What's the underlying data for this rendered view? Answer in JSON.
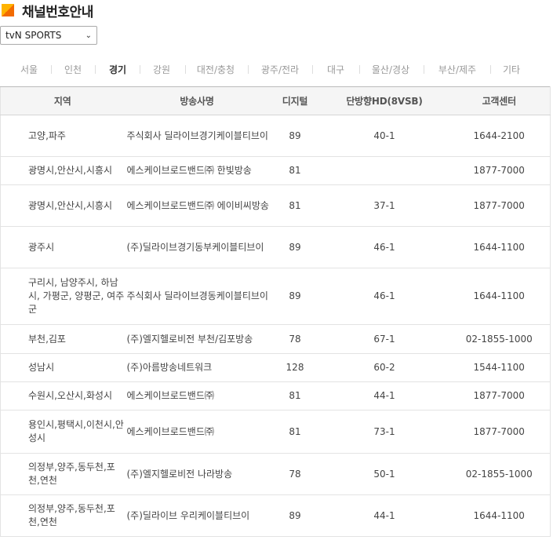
{
  "header": {
    "title": "채널번호안내"
  },
  "channel_select": {
    "value": "tvN SPORTS"
  },
  "tabs": [
    {
      "label": "서울",
      "active": false
    },
    {
      "label": "인천",
      "active": false
    },
    {
      "label": "경기",
      "active": true
    },
    {
      "label": "강원",
      "active": false
    },
    {
      "label": "대전/충청",
      "active": false
    },
    {
      "label": "광주/전라",
      "active": false
    },
    {
      "label": "대구",
      "active": false
    },
    {
      "label": "울산/경상",
      "active": false
    },
    {
      "label": "부산/제주",
      "active": false
    },
    {
      "label": "기타",
      "active": false
    }
  ],
  "table": {
    "headers": [
      "지역",
      "방송사명",
      "디지털",
      "단방향HD(8VSB)",
      "고객센터"
    ],
    "rows": [
      {
        "region": "고양,파주",
        "provider": "주식회사 딜라이브경기케이블티브이",
        "digital": "89",
        "hd": "40-1",
        "phone": "1644-2100"
      },
      {
        "region": "광명시,안산시,시흥시",
        "provider": "에스케이브로드밴드㈜ 한빛방송",
        "digital": "81",
        "hd": "",
        "phone": "1877-7000"
      },
      {
        "region": "광명시,안산시,시흥시",
        "provider": "에스케이브로드밴드㈜ 에이비씨방송",
        "digital": "81",
        "hd": "37-1",
        "phone": "1877-7000"
      },
      {
        "region": "광주시",
        "provider": "(주)딜라이브경기동부케이블티브이",
        "digital": "89",
        "hd": "46-1",
        "phone": "1644-1100"
      },
      {
        "region": "구리시, 남양주시, 하남시, 가평군, 양평군, 여주군",
        "provider": "주식회사 딜라이브경동케이블티브이",
        "digital": "89",
        "hd": "46-1",
        "phone": "1644-1100"
      },
      {
        "region": "부천,김포",
        "provider": "(주)엘지헬로비전 부천/김포방송",
        "digital": "78",
        "hd": "67-1",
        "phone": "02-1855-1000"
      },
      {
        "region": "성남시",
        "provider": "(주)아름방송네트워크",
        "digital": "128",
        "hd": "60-2",
        "phone": "1544-1100"
      },
      {
        "region": "수원시,오산시,화성시",
        "provider": "에스케이브로드밴드㈜",
        "digital": "81",
        "hd": "44-1",
        "phone": "1877-7000"
      },
      {
        "region": "용인시,평택시,이천시,안성시",
        "provider": "에스케이브로드밴드㈜",
        "digital": "81",
        "hd": "73-1",
        "phone": "1877-7000"
      },
      {
        "region": "의정부,양주,동두천,포천,연천",
        "provider": "(주)엘지헬로비전 나라방송",
        "digital": "78",
        "hd": "50-1",
        "phone": "02-1855-1000"
      },
      {
        "region": "의정부,양주,동두천,포천,연천",
        "provider": "(주)딜라이브 우리케이블티브이",
        "digital": "89",
        "hd": "44-1",
        "phone": "1644-1100"
      }
    ]
  }
}
